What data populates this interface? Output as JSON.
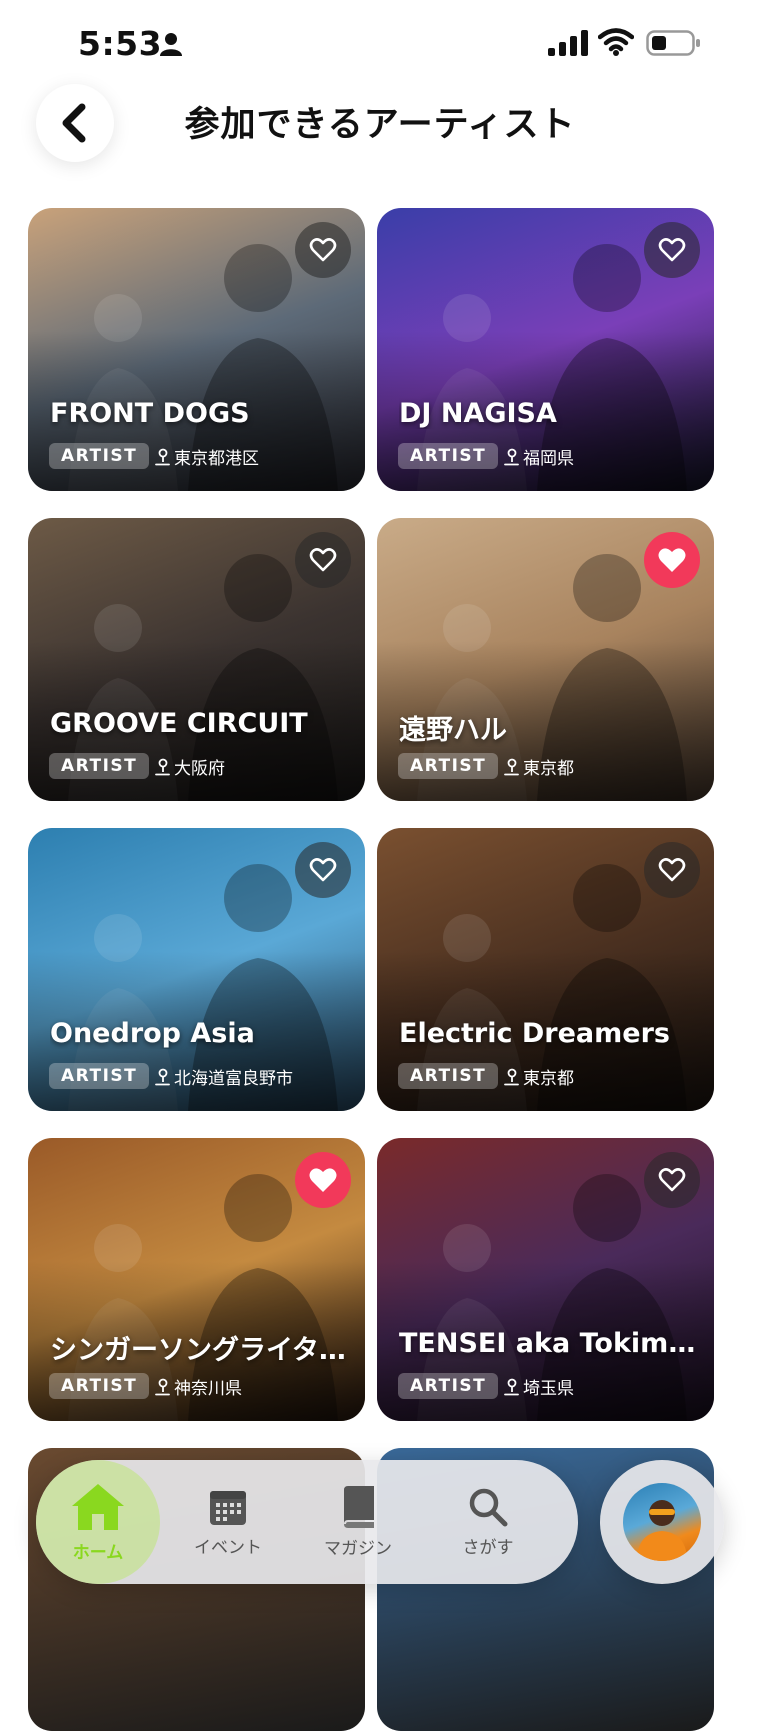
{
  "status_bar": {
    "time": "5:53"
  },
  "header": {
    "title": "参加できるアーティスト",
    "back_icon": "chevron-left-icon"
  },
  "cards": [
    {
      "name": "FRONT DOGS",
      "badge": "ARTIST",
      "location": "東京都港区",
      "favorite": false,
      "colors": [
        "#c9a27a",
        "#5d6a78",
        "#2a2b33"
      ]
    },
    {
      "name": "DJ NAGISA",
      "badge": "ARTIST",
      "location": "福岡県",
      "favorite": false,
      "colors": [
        "#3a3ea8",
        "#7a3fb8",
        "#15162a"
      ]
    },
    {
      "name": "GROOVE CIRCUIT",
      "badge": "ARTIST",
      "location": "大阪府",
      "favorite": false,
      "colors": [
        "#6d5a46",
        "#3b3330",
        "#1c1a19"
      ]
    },
    {
      "name": "遠野ハル",
      "badge": "ARTIST",
      "location": "東京都",
      "favorite": true,
      "colors": [
        "#c9ab88",
        "#a8835e",
        "#4a3a2e"
      ]
    },
    {
      "name": "Onedrop Asia",
      "badge": "ARTIST",
      "location": "北海道富良野市",
      "favorite": false,
      "colors": [
        "#2d7fb0",
        "#5aa8d6",
        "#2a4e6a"
      ]
    },
    {
      "name": "Electric Dreamers",
      "badge": "ARTIST",
      "location": "東京都",
      "favorite": false,
      "colors": [
        "#7a5030",
        "#4a3020",
        "#1d1510"
      ]
    },
    {
      "name": "シンガーソングライター…",
      "badge": "ARTIST",
      "location": "神奈川県",
      "favorite": true,
      "colors": [
        "#9a5a28",
        "#c48a40",
        "#2a1a10"
      ]
    },
    {
      "name": "TENSEI aka Tokim…",
      "badge": "ARTIST",
      "location": "埼玉県",
      "favorite": false,
      "colors": [
        "#7a2a2a",
        "#4a2a5a",
        "#1a1020"
      ]
    }
  ],
  "nav": {
    "items": [
      {
        "label": "ホーム",
        "icon": "home-icon",
        "active": true
      },
      {
        "label": "イベント",
        "icon": "calendar-icon",
        "active": false
      },
      {
        "label": "マガジン",
        "icon": "book-icon",
        "active": false
      },
      {
        "label": "さがす",
        "icon": "search-icon",
        "active": false
      }
    ],
    "profile_icon": "profile-avatar"
  },
  "accent_colors": {
    "favorite": "#f2395a",
    "nav_active": "#8ad81f"
  }
}
